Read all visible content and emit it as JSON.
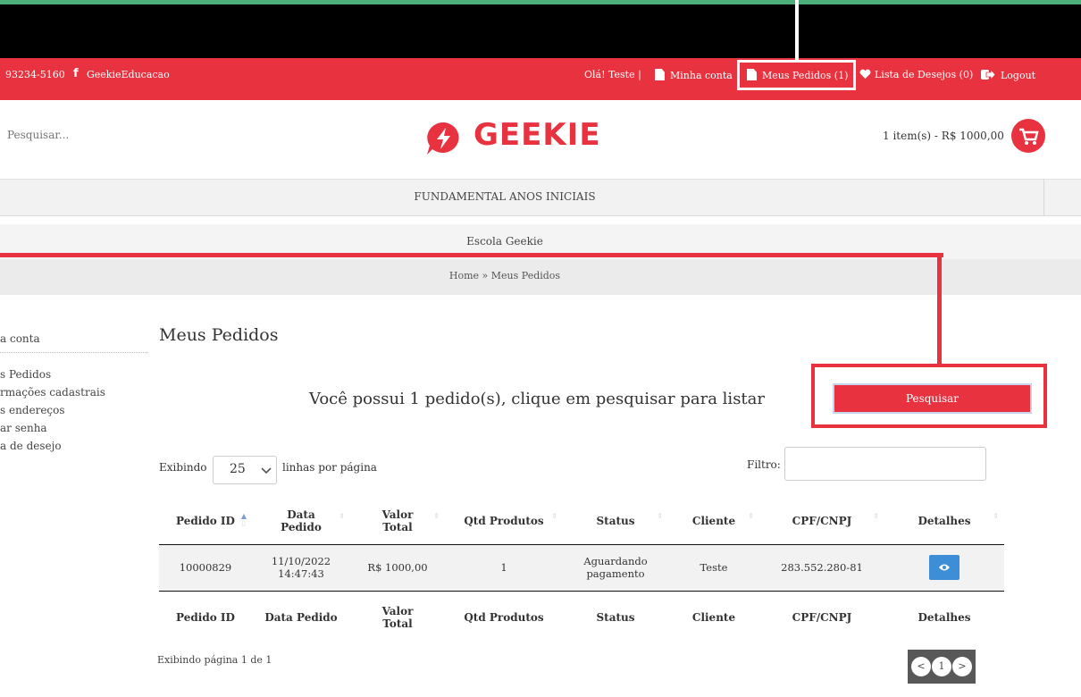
{
  "topbar": {
    "phone": "93234-5160",
    "facebook_icon": "f",
    "facebook": "GeekieEducacao",
    "greeting": "Olá! Teste |",
    "my_account": "Minha conta",
    "my_orders": "Meus Pedidos (1)",
    "wishlist": "Lista de Desejos (0)",
    "logout": "Logout"
  },
  "header": {
    "search_placeholder": "Pesquisar...",
    "logo_text": "GEEKIE",
    "cart": "1 item(s) - R$ 1000,00"
  },
  "nav": {
    "item": "FUNDAMENTAL ANOS INICIAIS"
  },
  "school": "Escola Geekie",
  "breadcrumb": "Home » Meus Pedidos",
  "sidebar": {
    "heading": "a conta",
    "items": [
      "s Pedidos",
      "rmações cadastrais",
      "s endereços",
      "ar senha",
      "a de desejo"
    ]
  },
  "main": {
    "title": "Meus Pedidos",
    "message": "Você possui 1 pedido(s), clique em pesquisar para listar",
    "search_button": "Pesquisar",
    "showing": "Exibindo",
    "page_size": "25",
    "per_page": "linhas por página",
    "filter_label": "Filtro:",
    "page_info": "Exibindo página 1 de 1"
  },
  "table": {
    "headers": [
      "Pedido ID",
      "Data Pedido",
      "Valor Total",
      "Qtd Produtos",
      "Status",
      "Cliente",
      "CPF/CNPJ",
      "Detalhes"
    ],
    "row": {
      "id": "10000829",
      "date": "11/10/2022 14:47:43",
      "value": "R$ 1000,00",
      "qty": "1",
      "status": "Aguardando pagamento",
      "client": "Teste",
      "cpf": "283.552.280-81",
      "details_icon": "eye-icon"
    }
  },
  "pager": {
    "prev": "<",
    "current": "1",
    "next": ">"
  },
  "colors": {
    "brand_red": "#e8323f",
    "details_blue": "#3d8ed7",
    "top_green": "#4caf7a"
  }
}
